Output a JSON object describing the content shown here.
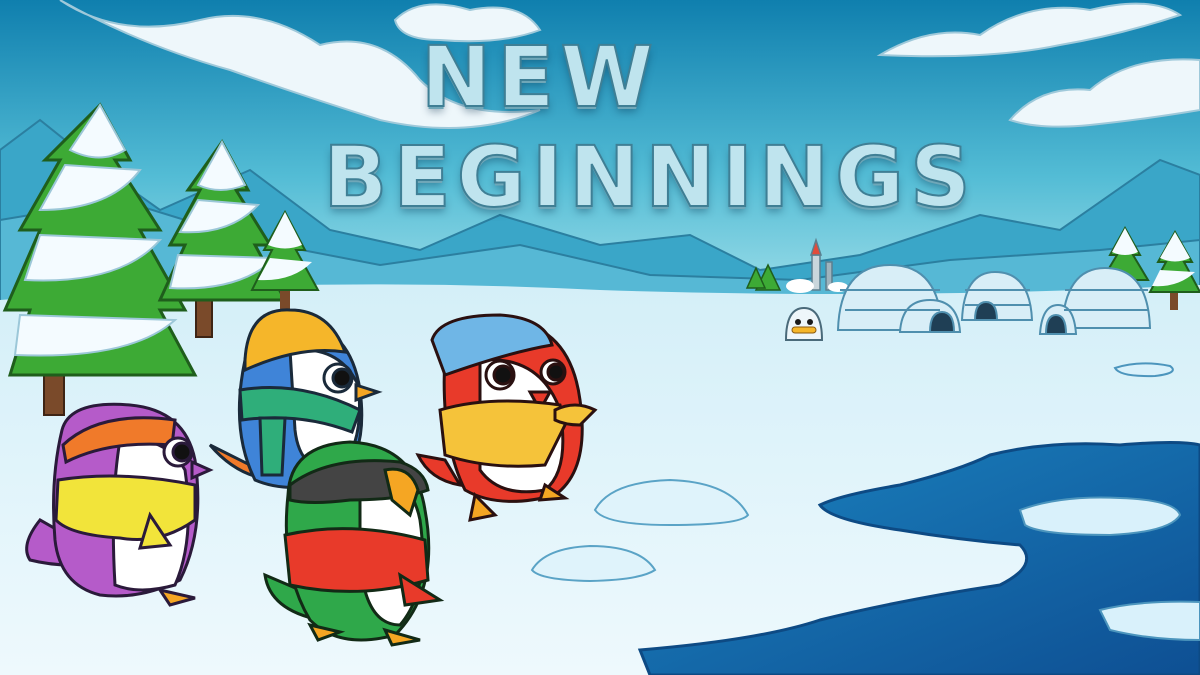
{
  "title": {
    "line1": "NEW",
    "line2": "BEGINNINGS"
  },
  "colors": {
    "sky_top": "#1289b3",
    "sky_bottom": "#8fd6e4",
    "snow": "#e8f6fc",
    "water": "#1a6fb0",
    "mountain": "#3fa7c9",
    "pine": "#3fae3a"
  },
  "characters": [
    {
      "name": "purple-penguin",
      "hat": "#f07a2a",
      "scarf": "#f2e43a"
    },
    {
      "name": "blue-penguin",
      "hat": "#f5b62a",
      "scarf": "#2fae7a"
    },
    {
      "name": "green-penguin",
      "hat": "#3e3e3e",
      "scarf": "#e83a2a"
    },
    {
      "name": "red-penguin",
      "hat": "#6fb6e6",
      "scarf": "#f5b62a"
    }
  ]
}
